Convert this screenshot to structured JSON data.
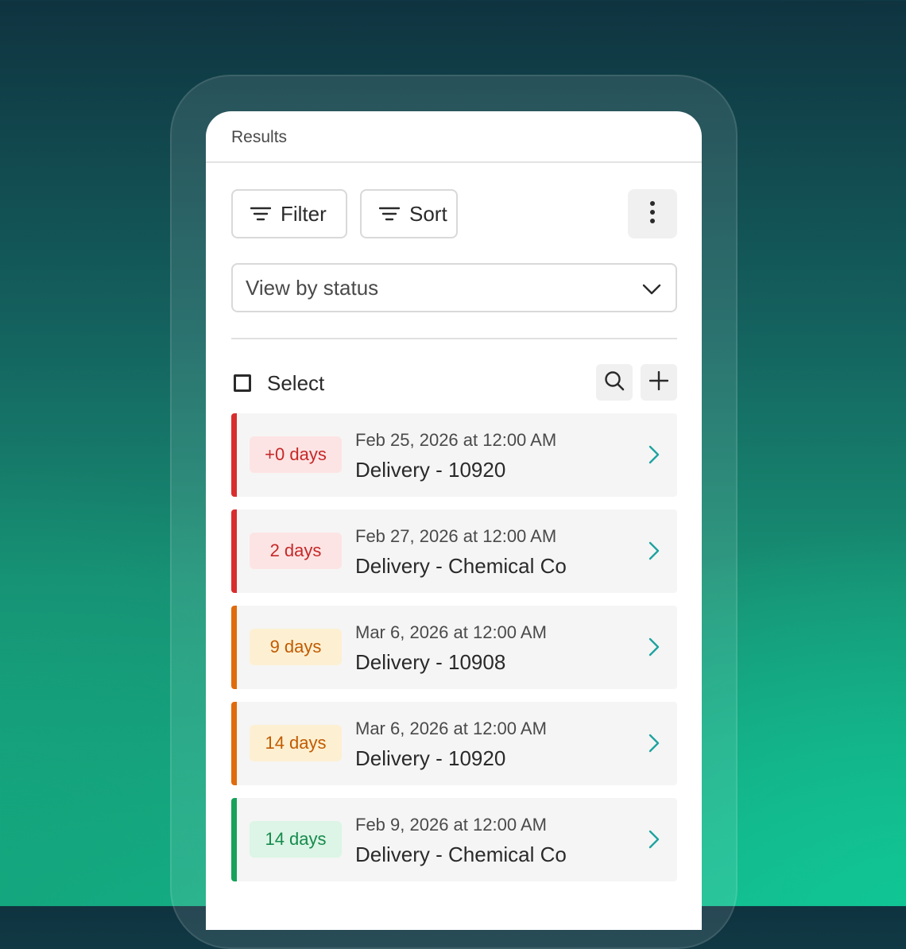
{
  "panel": {
    "title": "Results"
  },
  "toolbar": {
    "filter_label": "Filter",
    "sort_label": "Sort"
  },
  "view_select": {
    "value": "View by status"
  },
  "selection": {
    "label": "Select"
  },
  "colors": {
    "red": "#d92d2d",
    "red_bg": "#fde4e4",
    "red_text": "#c62828",
    "orange": "#e06b0c",
    "orange_bg": "#fdf0d2",
    "orange_text": "#c25a00",
    "green": "#17a15a",
    "green_bg": "#dcf5e6",
    "green_text": "#168a4c",
    "chevron": "#1fa3a0"
  },
  "items": [
    {
      "badge": "+0 days",
      "date": "Feb 25, 2026 at 12:00 AM",
      "name": "Delivery - 10920",
      "status": "red"
    },
    {
      "badge": "2 days",
      "date": "Feb 27, 2026 at 12:00 AM",
      "name": "Delivery - Chemical Co",
      "status": "red"
    },
    {
      "badge": "9 days",
      "date": "Mar 6, 2026 at 12:00 AM",
      "name": "Delivery - 10908",
      "status": "orange"
    },
    {
      "badge": "14 days",
      "date": "Mar 6, 2026 at 12:00 AM",
      "name": "Delivery - 10920",
      "status": "orange"
    },
    {
      "badge": "14 days",
      "date": "Feb 9, 2026 at 12:00 AM",
      "name": "Delivery - Chemical Co",
      "status": "green"
    }
  ]
}
